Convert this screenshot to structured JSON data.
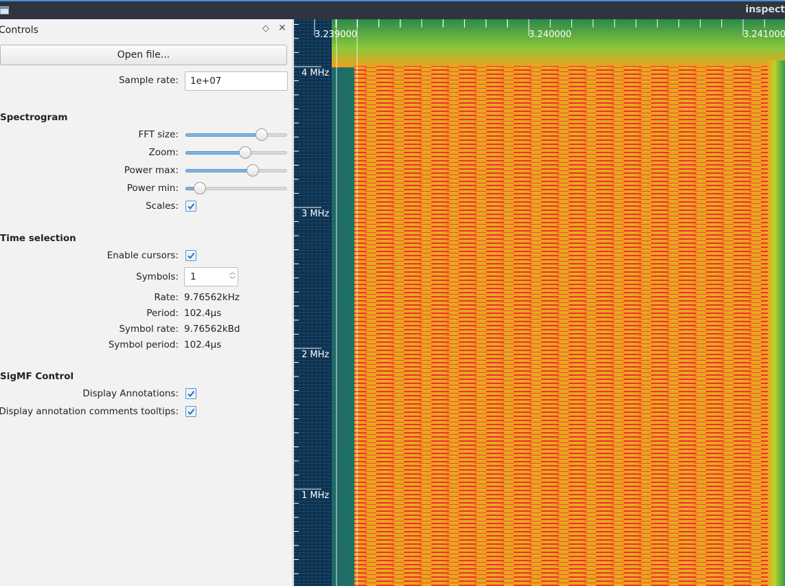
{
  "window": {
    "title": "inspect"
  },
  "dock": {
    "title": "Controls",
    "float_icon": "diamond-icon",
    "close_icon": "close-icon"
  },
  "open_file": {
    "label": "Open file..."
  },
  "sample_rate": {
    "label": "Sample rate:",
    "value": "1e+07"
  },
  "spectrogram": {
    "heading": "Spectrogram",
    "fft_size": {
      "label": "FFT size:",
      "level": 0.75
    },
    "zoom": {
      "label": "Zoom:",
      "level": 0.59
    },
    "power_max": {
      "label": "Power max:",
      "level": 0.66
    },
    "power_min": {
      "label": "Power min:",
      "level": 0.14
    },
    "scales": {
      "label": "Scales:",
      "checked": true
    }
  },
  "time_selection": {
    "heading": "Time selection",
    "enable_cursors": {
      "label": "Enable cursors:",
      "checked": true
    },
    "symbols": {
      "label": "Symbols:",
      "value": "1"
    },
    "rate": {
      "label": "Rate:",
      "value": "9.76562kHz"
    },
    "period": {
      "label": "Period:",
      "value": "102.4µs"
    },
    "symbol_rate": {
      "label": "Symbol rate:",
      "value": "9.76562kBd"
    },
    "symbol_period": {
      "label": "Symbol period:",
      "value": "102.4µs"
    }
  },
  "sigmf": {
    "heading": "SigMF Control",
    "display_annotations": {
      "label": "Display Annotations:",
      "checked": true
    },
    "display_tooltips": {
      "label": "Display annotation comments tooltips:",
      "checked": true
    }
  },
  "plot": {
    "time_ticks": [
      "3.239000",
      "3.240000",
      "3.241000"
    ],
    "freq_ticks": [
      "4 MHz",
      "3 MHz",
      "2 MHz",
      "1 MHz"
    ],
    "colors": {
      "background": "#0d2a46",
      "signal_hot": "#e8352a",
      "signal_warm": "#f0a020",
      "edge": "#3aa845"
    }
  }
}
